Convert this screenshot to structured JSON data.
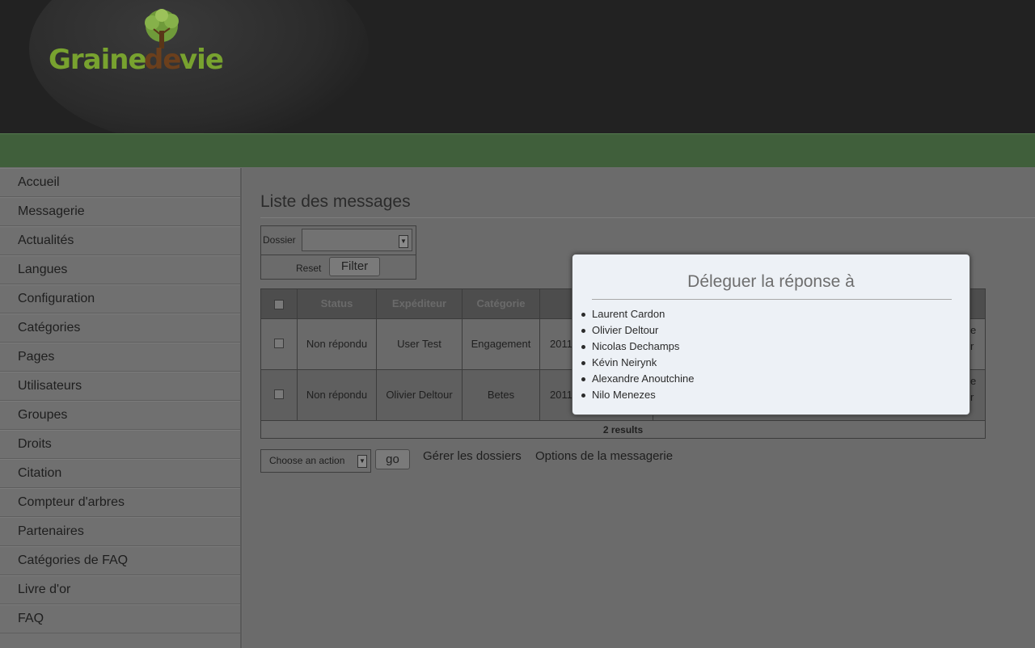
{
  "header": {
    "logo": {
      "word1": "Graine",
      "word2": "de",
      "word3": "vie",
      "icon": "tree-icon"
    }
  },
  "sidebar": {
    "items": [
      {
        "label": "Accueil"
      },
      {
        "label": "Messagerie"
      },
      {
        "label": "Actualités"
      },
      {
        "label": "Langues"
      },
      {
        "label": "Configuration"
      },
      {
        "label": "Catégories"
      },
      {
        "label": "Pages"
      },
      {
        "label": "Utilisateurs"
      },
      {
        "label": "Groupes"
      },
      {
        "label": "Droits"
      },
      {
        "label": "Citation"
      },
      {
        "label": "Compteur d'arbres"
      },
      {
        "label": "Partenaires"
      },
      {
        "label": "Catégories de FAQ"
      },
      {
        "label": "Livre d'or"
      },
      {
        "label": "FAQ"
      }
    ]
  },
  "main": {
    "title": "Liste des messages",
    "filter": {
      "dossier_label": "Dossier",
      "dossier_value": "",
      "reset_label": "Reset",
      "filter_button": "Filter"
    },
    "table": {
      "headers": [
        "",
        "Status",
        "Expéditeur",
        "Catégorie"
      ],
      "rows": [
        {
          "status": "Non répondu",
          "sender": "User Test",
          "category": "Engagement",
          "date_partial": "2011",
          "trailing_partial": [
            "e",
            "r"
          ]
        },
        {
          "status": "Non répondu",
          "sender": "Olivier Deltour",
          "category": "Betes",
          "date_partial": "2011",
          "trailing_partial": [
            "e",
            "r"
          ]
        }
      ],
      "footer": "2 results"
    },
    "actions": {
      "select_value": "Choose an action",
      "go_button": "go",
      "links": [
        "Gérer les dossiers",
        "Options de la messagerie"
      ]
    }
  },
  "modal": {
    "title": "Déleguer la réponse à",
    "people": [
      "Laurent Cardon",
      "Olivier Deltour",
      "Nicolas Dechamps",
      "Kévin Neirynk",
      "Alexandre Anoutchine",
      "Nilo Menezes"
    ]
  },
  "colors": {
    "header_bg": "#222222",
    "green_bar": "#405f3b",
    "logo_green": "#78a22f",
    "logo_brown": "#6b3f1c",
    "modal_bg": "#edf1f6"
  }
}
